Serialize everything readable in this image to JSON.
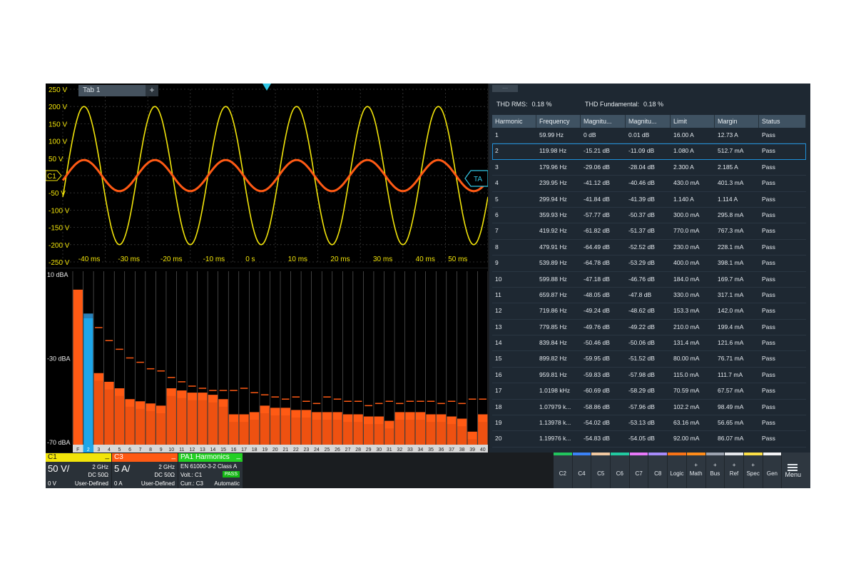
{
  "waveform": {
    "tab_label": "Tab 1",
    "add_tab_label": "+",
    "y_labels": [
      "250 V",
      "200 V",
      "150 V",
      "100 V",
      "50 V",
      "0 V",
      "-50 V",
      "-100 V",
      "-150 V",
      "-200 V",
      "-250 V"
    ],
    "x_labels": [
      "-40 ms",
      "-30 ms",
      "-20 ms",
      "-10 ms",
      "0 s",
      "10 ms",
      "20 ms",
      "30 ms",
      "40 ms",
      "50 ms"
    ],
    "channel_marker": "C1",
    "trigger_marker": "TA",
    "series": [
      {
        "name": "C1",
        "color": "#f2e40a",
        "amplitude_v": 200,
        "frequency_hz": 60
      },
      {
        "name": "C3",
        "color": "#ff5a14",
        "amplitude_v": 45,
        "frequency_hz": 60
      }
    ]
  },
  "harmonics_chart": {
    "y_labels": [
      "10 dBA",
      "-30 dBA",
      "-70 dBA"
    ],
    "ylim": [
      -70,
      10
    ],
    "categories": [
      "F",
      "2",
      "3",
      "4",
      "5",
      "6",
      "7",
      "8",
      "9",
      "10",
      "11",
      "12",
      "13",
      "14",
      "15",
      "16",
      "17",
      "18",
      "19",
      "20",
      "21",
      "22",
      "23",
      "24",
      "25",
      "26",
      "27",
      "28",
      "29",
      "30",
      "31",
      "32",
      "33",
      "34",
      "35",
      "36",
      "37",
      "38",
      "39",
      "40"
    ],
    "values": [
      1.5,
      -11.5,
      -37,
      -41,
      -44,
      -49,
      -50,
      -51,
      -52,
      -44,
      -45,
      -46,
      -46,
      -47,
      -49,
      -56,
      -56,
      -55,
      -52,
      -53,
      -53,
      -54,
      -54,
      -55,
      -55,
      -55,
      -56,
      -56,
      -57,
      -57,
      -59,
      -55,
      -55,
      -55,
      -56,
      -56,
      -57,
      -58,
      -64,
      -56
    ],
    "limits": [
      null,
      null,
      -16,
      -22,
      -26,
      -30,
      -32,
      -35,
      -36,
      -39,
      -41,
      -43,
      -44,
      -45,
      -45,
      -45,
      -44,
      -46,
      -47,
      -48,
      -49,
      -48,
      -50,
      -51,
      -48,
      -49,
      -50,
      -50,
      -52,
      -51,
      -50,
      -51,
      -50,
      -50,
      -50,
      -51,
      -50,
      -51,
      -49,
      -49
    ],
    "selected_index": 1,
    "bar_color": "#ff5a14",
    "selected_color": "#1fa6e8",
    "limit_color": "#ff5a14"
  },
  "badges": {
    "c1": {
      "title": "C1",
      "scale": "50 V/",
      "bw": "2 GHz",
      "coupling": "DC 50Ω",
      "offset": "0 V",
      "mode": "User-Defined",
      "color": "#f2e40a"
    },
    "c3": {
      "title": "C3",
      "scale": "5 A/",
      "bw": "2 GHz",
      "coupling": "DC 50Ω",
      "offset": "0 A",
      "mode": "User-Defined",
      "color": "#ff5a14"
    },
    "pa1": {
      "title": "PA1 Harmonics",
      "standard": "EN 61000-3-2 Class A",
      "volt": "Volt.: C1",
      "curr": "Curr.: C3",
      "status": "PASS",
      "mode": "Automatic",
      "color": "#24d024"
    }
  },
  "results": {
    "tab_label": "....",
    "thd_rms_label": "THD RMS:",
    "thd_rms_value": "0.18 %",
    "thd_fund_label": "THD Fundamental:",
    "thd_fund_value": "0.18 %",
    "columns": [
      "Harmonic",
      "Frequency",
      "Magnitu...",
      "Magnitu...",
      "Limit",
      "Margin",
      "Status"
    ],
    "selected_row": 1,
    "rows": [
      [
        "1",
        "59.99 Hz",
        "0 dB",
        "0.01 dB",
        "16.00 A",
        "12.73 A",
        "Pass"
      ],
      [
        "2",
        "119.98 Hz",
        "-15.21 dB",
        "-11.09 dB",
        "1.080 A",
        "512.7 mA",
        "Pass"
      ],
      [
        "3",
        "179.96 Hz",
        "-29.06 dB",
        "-28.04 dB",
        "2.300 A",
        "2.185 A",
        "Pass"
      ],
      [
        "4",
        "239.95 Hz",
        "-41.12 dB",
        "-40.46 dB",
        "430.0 mA",
        "401.3 mA",
        "Pass"
      ],
      [
        "5",
        "299.94 Hz",
        "-41.84 dB",
        "-41.39 dB",
        "1.140 A",
        "1.114 A",
        "Pass"
      ],
      [
        "6",
        "359.93 Hz",
        "-57.77 dB",
        "-50.37 dB",
        "300.0 mA",
        "295.8 mA",
        "Pass"
      ],
      [
        "7",
        "419.92 Hz",
        "-61.82 dB",
        "-51.37 dB",
        "770.0 mA",
        "767.3 mA",
        "Pass"
      ],
      [
        "8",
        "479.91 Hz",
        "-64.49 dB",
        "-52.52 dB",
        "230.0 mA",
        "228.1 mA",
        "Pass"
      ],
      [
        "9",
        "539.89 Hz",
        "-64.78 dB",
        "-53.29 dB",
        "400.0 mA",
        "398.1 mA",
        "Pass"
      ],
      [
        "10",
        "599.88 Hz",
        "-47.18 dB",
        "-46.76 dB",
        "184.0 mA",
        "169.7 mA",
        "Pass"
      ],
      [
        "11",
        "659.87 Hz",
        "-48.05 dB",
        "-47.8 dB",
        "330.0 mA",
        "317.1 mA",
        "Pass"
      ],
      [
        "12",
        "719.86 Hz",
        "-49.24 dB",
        "-48.62 dB",
        "153.3 mA",
        "142.0 mA",
        "Pass"
      ],
      [
        "13",
        "779.85 Hz",
        "-49.76 dB",
        "-49.22 dB",
        "210.0 mA",
        "199.4 mA",
        "Pass"
      ],
      [
        "14",
        "839.84 Hz",
        "-50.46 dB",
        "-50.06 dB",
        "131.4 mA",
        "121.6 mA",
        "Pass"
      ],
      [
        "15",
        "899.82 Hz",
        "-59.95 dB",
        "-51.52 dB",
        "80.00 mA",
        "76.71 mA",
        "Pass"
      ],
      [
        "16",
        "959.81 Hz",
        "-59.83 dB",
        "-57.98 dB",
        "115.0 mA",
        "111.7 mA",
        "Pass"
      ],
      [
        "17",
        "1.0198 kHz",
        "-60.69 dB",
        "-58.29 dB",
        "70.59 mA",
        "67.57 mA",
        "Pass"
      ],
      [
        "18",
        "1.07979 k...",
        "-58.86 dB",
        "-57.96 dB",
        "102.2 mA",
        "98.49 mA",
        "Pass"
      ],
      [
        "19",
        "1.13978 k...",
        "-54.02 dB",
        "-53.13 dB",
        "63.16 mA",
        "56.65 mA",
        "Pass"
      ],
      [
        "20",
        "1.19976 k...",
        "-54.83 dB",
        "-54.05 dB",
        "92.00 mA",
        "86.07 mA",
        "Pass"
      ]
    ]
  },
  "toolbar": {
    "buttons": [
      {
        "label": "C2",
        "color": "#22c55e",
        "plus": ""
      },
      {
        "label": "C4",
        "color": "#3b82f6",
        "plus": ""
      },
      {
        "label": "C5",
        "color": "#f0c8a0",
        "plus": ""
      },
      {
        "label": "C6",
        "color": "#22c9a0",
        "plus": ""
      },
      {
        "label": "C7",
        "color": "#e879f9",
        "plus": ""
      },
      {
        "label": "C8",
        "color": "#a78bfa",
        "plus": ""
      },
      {
        "label": "Logic",
        "color": "#f97316",
        "plus": ""
      },
      {
        "label": "Math",
        "color": "#ff8c1a",
        "plus": "+"
      },
      {
        "label": "Bus",
        "color": "#9ca3af",
        "plus": "+"
      },
      {
        "label": "Ref",
        "color": "#e5e7eb",
        "plus": "+"
      },
      {
        "label": "Spec",
        "color": "#fde047",
        "plus": "+"
      },
      {
        "label": "Gen",
        "color": "#f3f4f6",
        "plus": ""
      }
    ],
    "menu_label": "Menu"
  }
}
